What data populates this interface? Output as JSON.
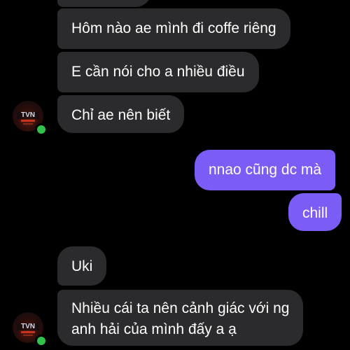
{
  "chat": {
    "messages": [
      {
        "direction": "incoming",
        "text": ""
      },
      {
        "direction": "incoming",
        "text": "Hôm nào ae mình đi coffe riêng"
      },
      {
        "direction": "incoming",
        "text": "E cần nói cho a nhiều điều"
      },
      {
        "direction": "incoming",
        "text": "Chỉ ae nên biết"
      },
      {
        "direction": "outgoing",
        "text": "nnao cũng dc mà"
      },
      {
        "direction": "outgoing",
        "text": "chill"
      },
      {
        "direction": "incoming",
        "text": "Uki"
      },
      {
        "direction": "incoming",
        "text_lines": [
          "Nhiều cái ta nên cảnh giác với ng",
          "anh hải của mình đấy a ạ"
        ]
      }
    ],
    "avatar": {
      "logo_text": "TVN",
      "online": true
    },
    "colors": {
      "background": "#000000",
      "incoming_bubble": "#2b2b2d",
      "outgoing_bubble": "#7b5cf5",
      "online_dot": "#31c24d"
    }
  }
}
